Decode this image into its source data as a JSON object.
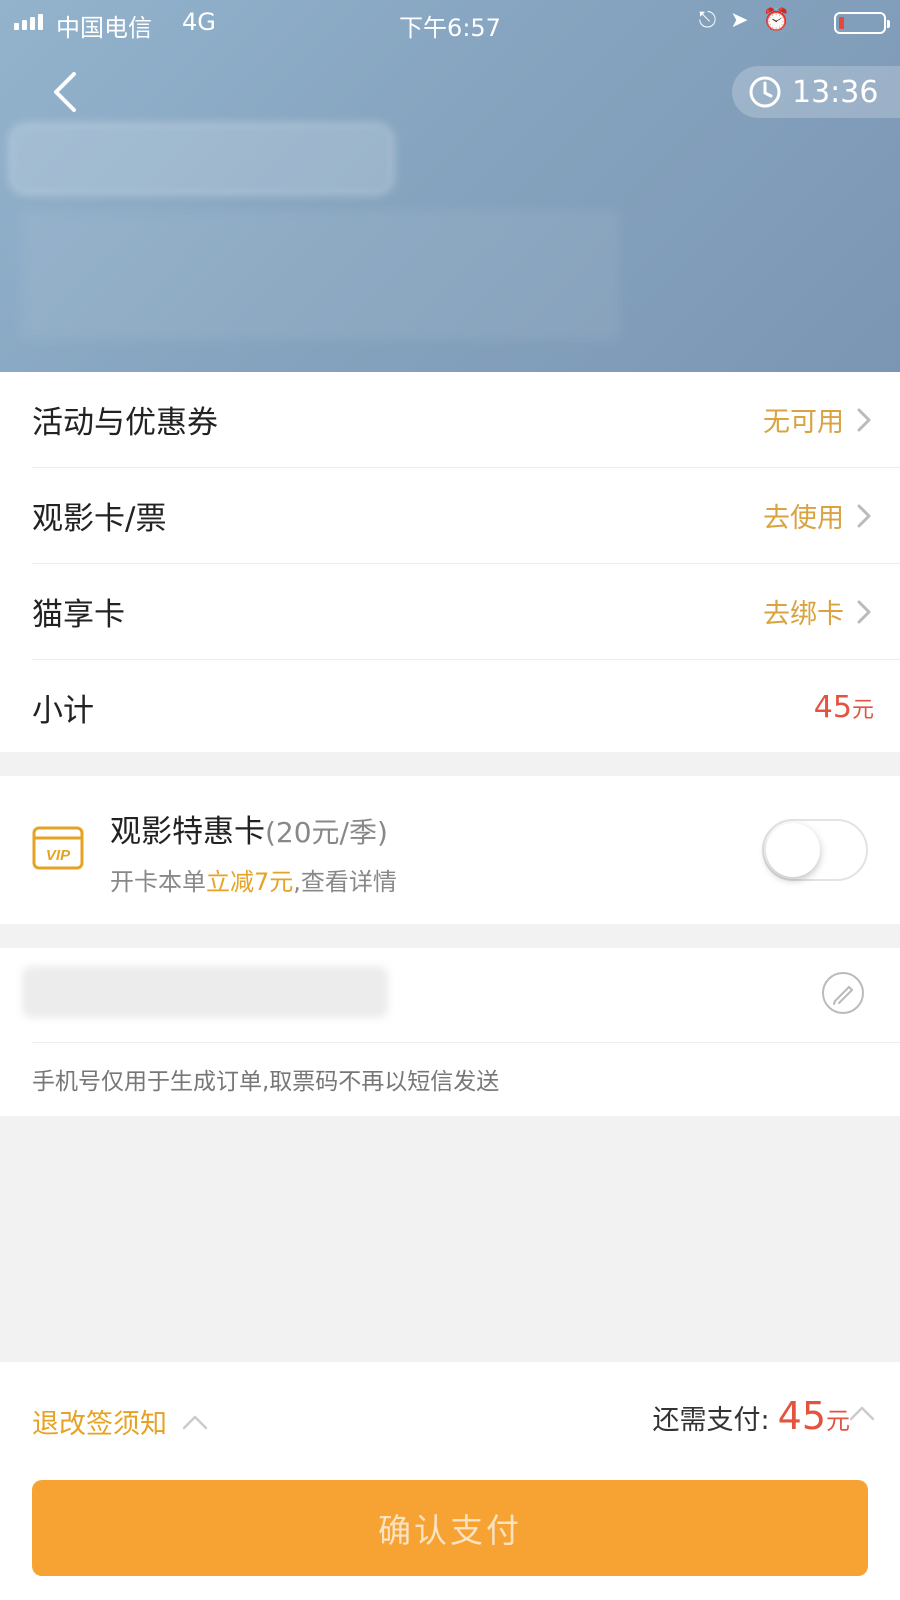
{
  "status_bar": {
    "carrier": "中国电信",
    "network": "4G",
    "time": "下午6:57"
  },
  "header": {
    "timer": "13:36"
  },
  "rows": [
    {
      "label": "活动与优惠券",
      "value": "无可用"
    },
    {
      "label": "观影卡/票",
      "value": "去使用"
    },
    {
      "label": "猫享卡",
      "value": "去绑卡"
    },
    {
      "label": "小计",
      "amount": "45",
      "unit": "元"
    }
  ],
  "vip": {
    "icon_text": "VIP",
    "title": "观影特惠卡",
    "price": "(20元/季)",
    "sub_prefix": "开卡本单",
    "sub_highlight": "立减7元",
    "sub_suffix": ",查看详情",
    "enabled": false
  },
  "phone": {
    "note": "手机号仅用于生成订单,取票码不再以短信发送"
  },
  "footer": {
    "refund_label": "退改签须知",
    "topay_label": "还需支付:",
    "topay_amount": "45",
    "topay_unit": "元",
    "confirm_label": "确认支付"
  },
  "colors": {
    "accent": "#f6a333",
    "price": "#e2543f",
    "link": "#d9a33f",
    "header_bg": "#86a4bf"
  }
}
